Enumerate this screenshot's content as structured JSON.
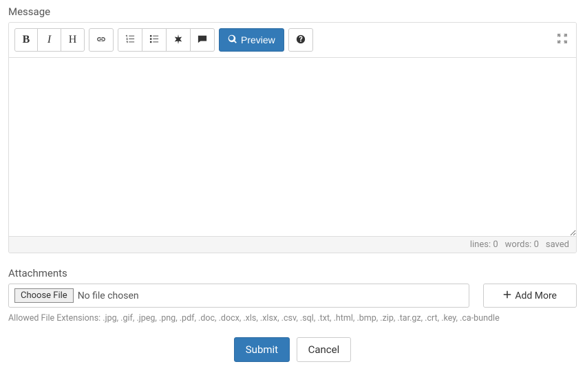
{
  "message": {
    "label": "Message",
    "toolbar": {
      "bold": "B",
      "italic": "I",
      "heading": "H",
      "preview_label": "Preview"
    },
    "status": {
      "lines_label": "lines:",
      "lines_value": "0",
      "words_label": "words:",
      "words_value": "0",
      "saved_label": "saved"
    }
  },
  "attachments": {
    "label": "Attachments",
    "choose_file_label": "Choose File",
    "no_file_chosen": "No file chosen",
    "add_more_label": "Add More",
    "hint_prefix": "Allowed File Extensions:",
    "hint_exts": ".jpg, .gif, .jpeg, .png, .pdf, .doc, .docx, .xls, .xlsx, .csv, .sql, .txt, .html, .bmp, .zip, .tar.gz, .crt, .key, .ca-bundle"
  },
  "actions": {
    "submit": "Submit",
    "cancel": "Cancel"
  }
}
